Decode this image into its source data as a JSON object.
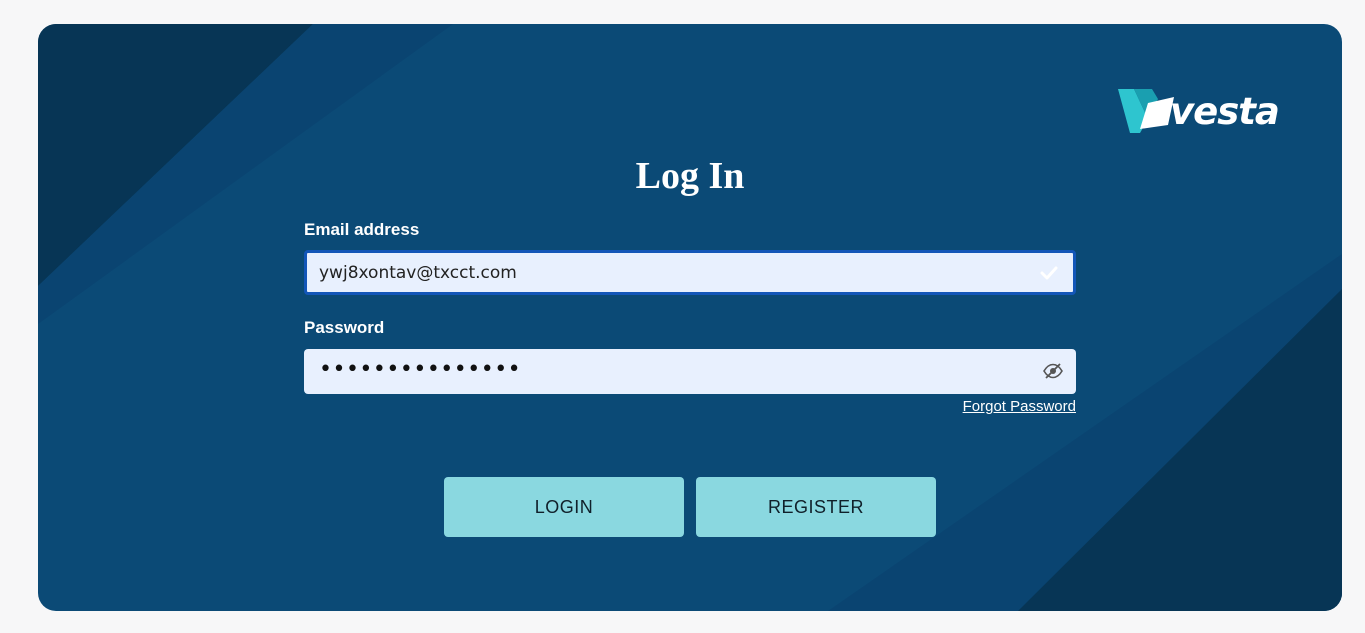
{
  "brand": {
    "name": "vesta",
    "logo_icon": "vesta-v-logo-icon"
  },
  "title": "Log In",
  "email": {
    "label": "Email address",
    "value": "ywj8xontav@txcct.com",
    "status_icon": "check-icon"
  },
  "password": {
    "label": "Password",
    "masked_value": "•••••••••••••••",
    "toggle_icon": "eye-slash-icon"
  },
  "forgot_password": "Forgot Password",
  "buttons": {
    "login": "LOGIN",
    "register": "REGISTER"
  },
  "colors": {
    "card_background": "#0b4a76",
    "accent": "#8ad8e0",
    "logo_accent": "#2ec5cf"
  }
}
